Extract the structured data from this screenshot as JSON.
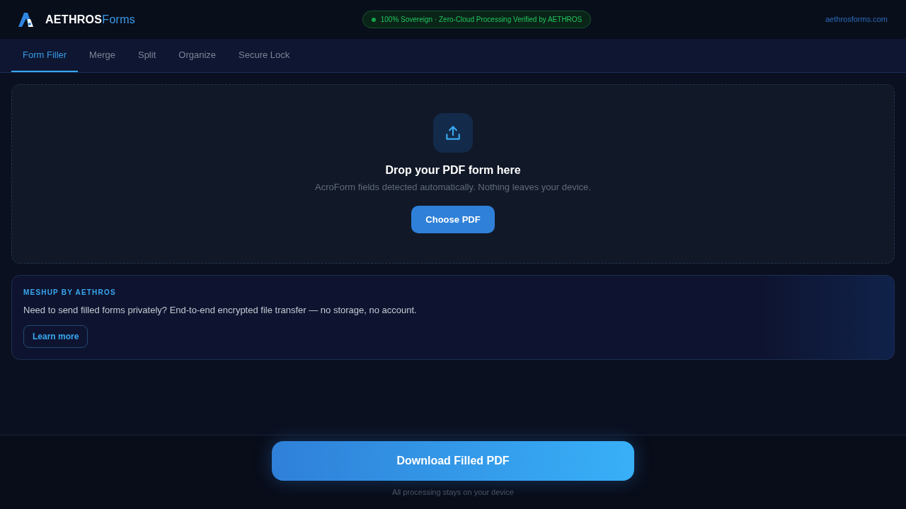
{
  "brand": {
    "name": "AETHROS",
    "product": "Forms"
  },
  "badge": {
    "text": "100% Sovereign · Zero-Cloud Processing Verified by AETHROS"
  },
  "site_link": "aethrosforms.com",
  "tabs": [
    {
      "label": "Form Filler",
      "selected": true
    },
    {
      "label": "Merge",
      "selected": false
    },
    {
      "label": "Split",
      "selected": false
    },
    {
      "label": "Organize",
      "selected": false
    },
    {
      "label": "Secure Lock",
      "selected": false
    }
  ],
  "dropzone": {
    "title": "Drop your PDF form here",
    "subtitle": "AcroForm fields detected automatically. Nothing leaves your device.",
    "button": "Choose PDF"
  },
  "promo": {
    "eyebrow": "MESHUP BY AETHROS",
    "text": "Need to send filled forms privately? End-to-end encrypted file transfer — no storage, no account.",
    "button": "Learn more"
  },
  "footer": {
    "button": "Download Filled PDF",
    "caption": "All processing stays on your device"
  }
}
